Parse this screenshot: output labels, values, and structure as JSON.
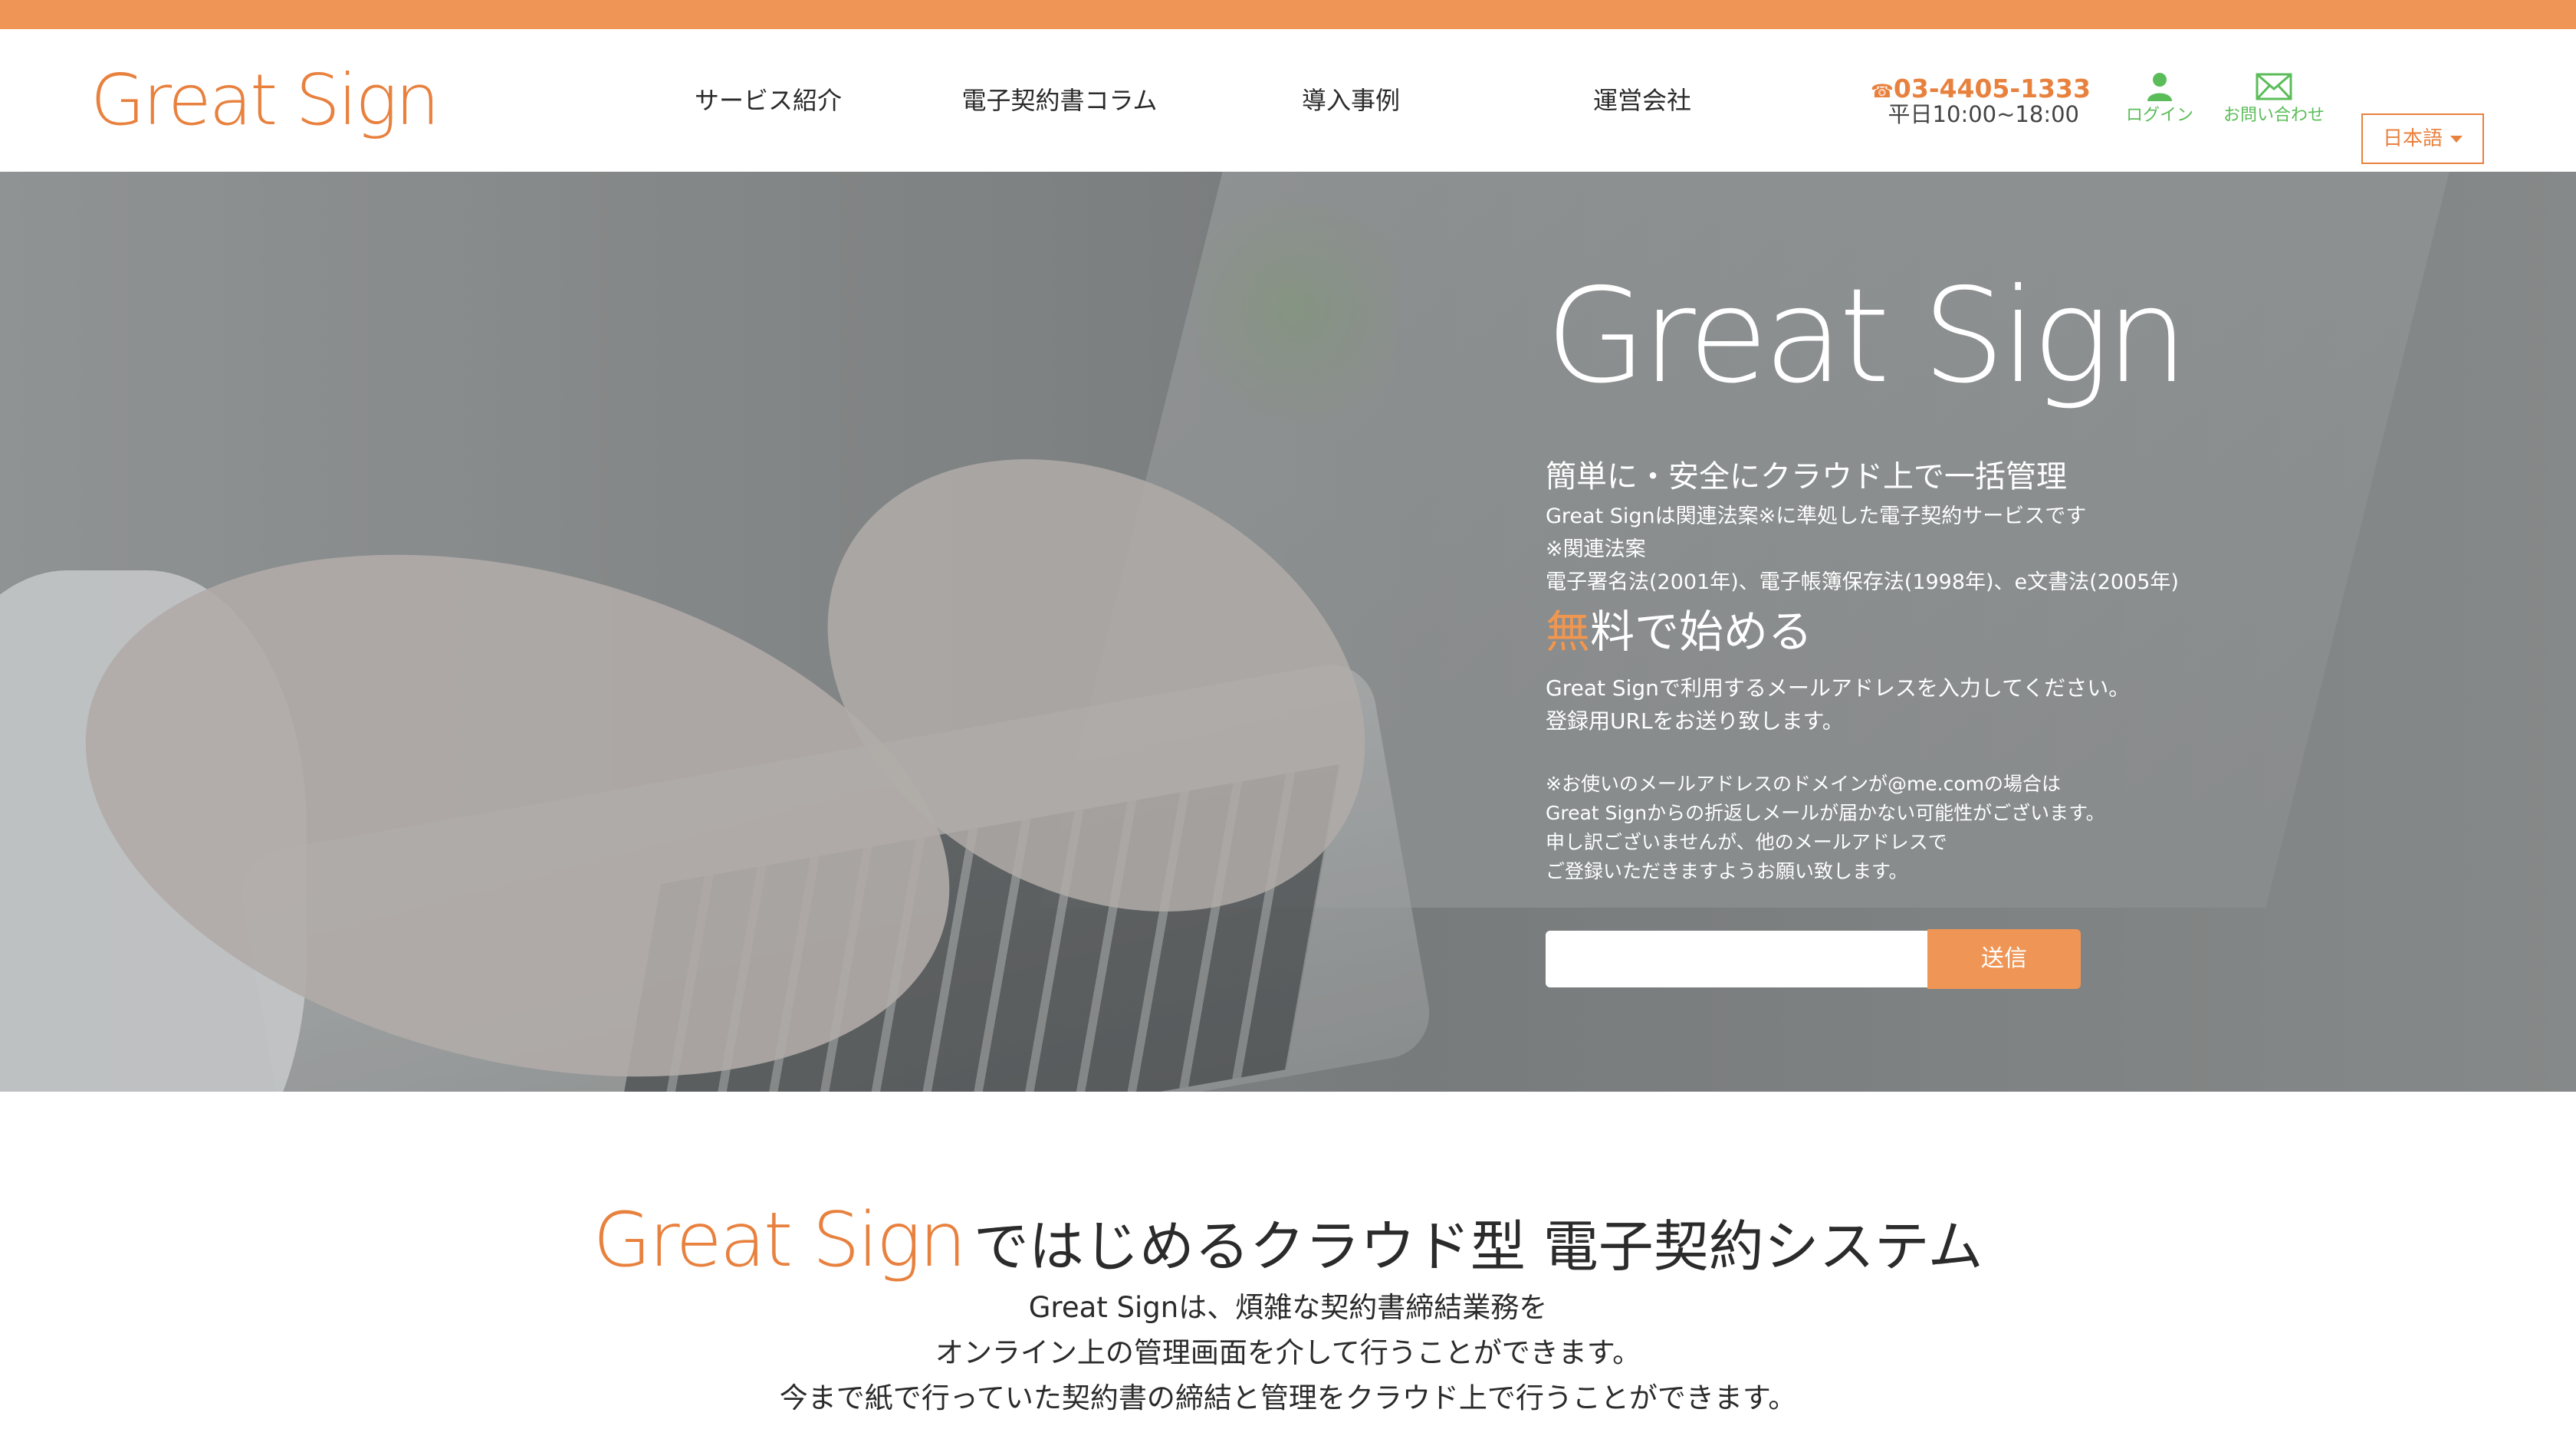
{
  "header": {
    "logo": "Great Sign",
    "nav": [
      "サービス紹介",
      "電子契約書コラム",
      "導入事例",
      "運営会社"
    ],
    "phone_icon": "☎",
    "phone": "03-4405-1333",
    "hours": "平日10:00~18:00",
    "login_label": "ログイン",
    "contact_label": "お問い合わせ",
    "language": "日本語"
  },
  "hero": {
    "logo": "Great Sign",
    "tagline": "簡単に・安全にクラウド上で一括管理",
    "line1": "Great Signは関連法案※に準処した電子契約サービスです",
    "line2": "※関連法案",
    "line3": "電子署名法(2001年)、電子帳簿保存法(1998年)、e文書法(2005年)",
    "free_first": "無",
    "free_rest": "料で始める",
    "intro1": "Great Signで利用するメールアドレスを入力してください。",
    "intro2": "登録用URLをお送り致します。",
    "note1": "※お使いのメールアドレスのドメインが@me.comの場合は",
    "note2": "Great Signからの折返しメールが届かない可能性がございます。",
    "note3": "申し訳ございませんが、他のメールアドレスで",
    "note4": "ご登録いただきますようお願い致します。",
    "email_value": "",
    "submit_label": "送信"
  },
  "section": {
    "title_logo": "Great Sign",
    "title_rest": "ではじめるクラウド型 電子契約システム",
    "desc1": "Great Signは、煩雑な契約書締結業務を",
    "desc2": "オンライン上の管理画面を介して行うことができます。",
    "desc3": "今まで紙で行っていた契約書の締結と管理をクラウド上で行うことができます。"
  },
  "colors": {
    "accent": "#e8813e",
    "topbar": "#ef9656",
    "icon_green": "#5bbd59"
  },
  "icons": [
    "phone-icon",
    "person-icon",
    "mail-icon",
    "chevron-down-icon"
  ]
}
